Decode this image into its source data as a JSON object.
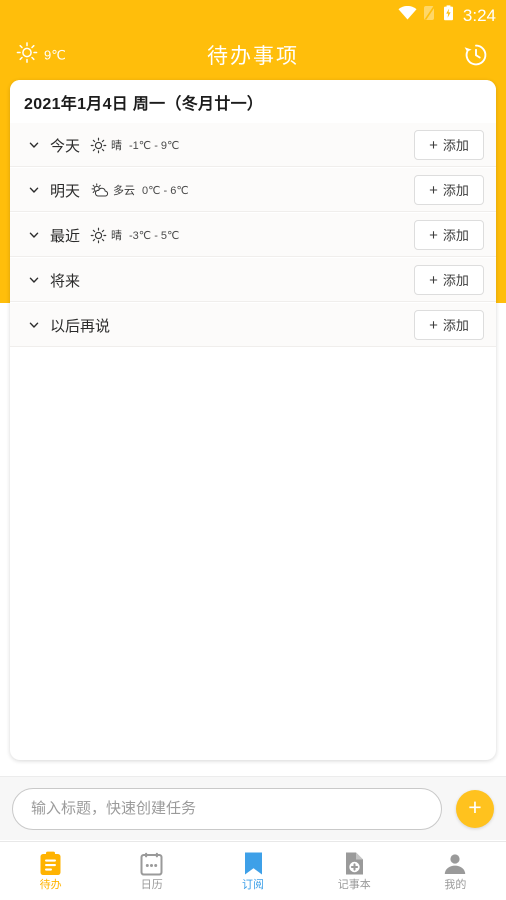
{
  "theme": {
    "accent": "#FFBE0B",
    "fab": "#FFC21E",
    "active_orange": "#FFB300",
    "active_blue": "#3EA0E8",
    "card_bg": "#FFFFFF",
    "row_bg": "#FCFBFA"
  },
  "statusbar": {
    "wifi_icon": "wifi-icon",
    "signal_icon": "signal-off-icon",
    "battery_icon": "battery-charging-icon",
    "time": "3:24"
  },
  "titlebar": {
    "weather_icon": "sun-icon",
    "temperature": "9℃",
    "title": "待办事项",
    "history_icon": "history-icon"
  },
  "card": {
    "date_header": "2021年1月4日 周一（冬月廿一）",
    "groups": [
      {
        "chevron_icon": "chevron-down-icon",
        "name": "今天",
        "weather_icon": "sun-icon",
        "weather_desc": "晴",
        "temp_range": "-1℃ - 9℃",
        "add_icon": "plus-icon",
        "add_label": "添加"
      },
      {
        "chevron_icon": "chevron-down-icon",
        "name": "明天",
        "weather_icon": "sun-cloud-icon",
        "weather_desc": "多云",
        "temp_range": "0℃ - 6℃",
        "add_icon": "plus-icon",
        "add_label": "添加"
      },
      {
        "chevron_icon": "chevron-down-icon",
        "name": "最近",
        "weather_icon": "sun-icon",
        "weather_desc": "晴",
        "temp_range": "-3℃ - 5℃",
        "add_icon": "plus-icon",
        "add_label": "添加"
      },
      {
        "chevron_icon": "chevron-down-icon",
        "name": "将来",
        "weather_icon": "",
        "weather_desc": "",
        "temp_range": "",
        "add_icon": "plus-icon",
        "add_label": "添加"
      },
      {
        "chevron_icon": "chevron-down-icon",
        "name": "以后再说",
        "weather_icon": "",
        "weather_desc": "",
        "temp_range": "",
        "add_icon": "plus-icon",
        "add_label": "添加"
      }
    ]
  },
  "quickbar": {
    "input_value": "",
    "input_placeholder": "输入标题，快速创建任务",
    "fab_icon": "plus-icon"
  },
  "bottomnav": {
    "items": [
      {
        "icon": "clipboard-icon",
        "label": "待办",
        "state": "active-orange"
      },
      {
        "icon": "calendar-icon",
        "label": "日历",
        "state": "inactive"
      },
      {
        "icon": "bookmark-icon",
        "label": "订阅",
        "state": "active-blue"
      },
      {
        "icon": "note-plus-icon",
        "label": "记事本",
        "state": "inactive"
      },
      {
        "icon": "person-icon",
        "label": "我的",
        "state": "inactive"
      }
    ]
  }
}
